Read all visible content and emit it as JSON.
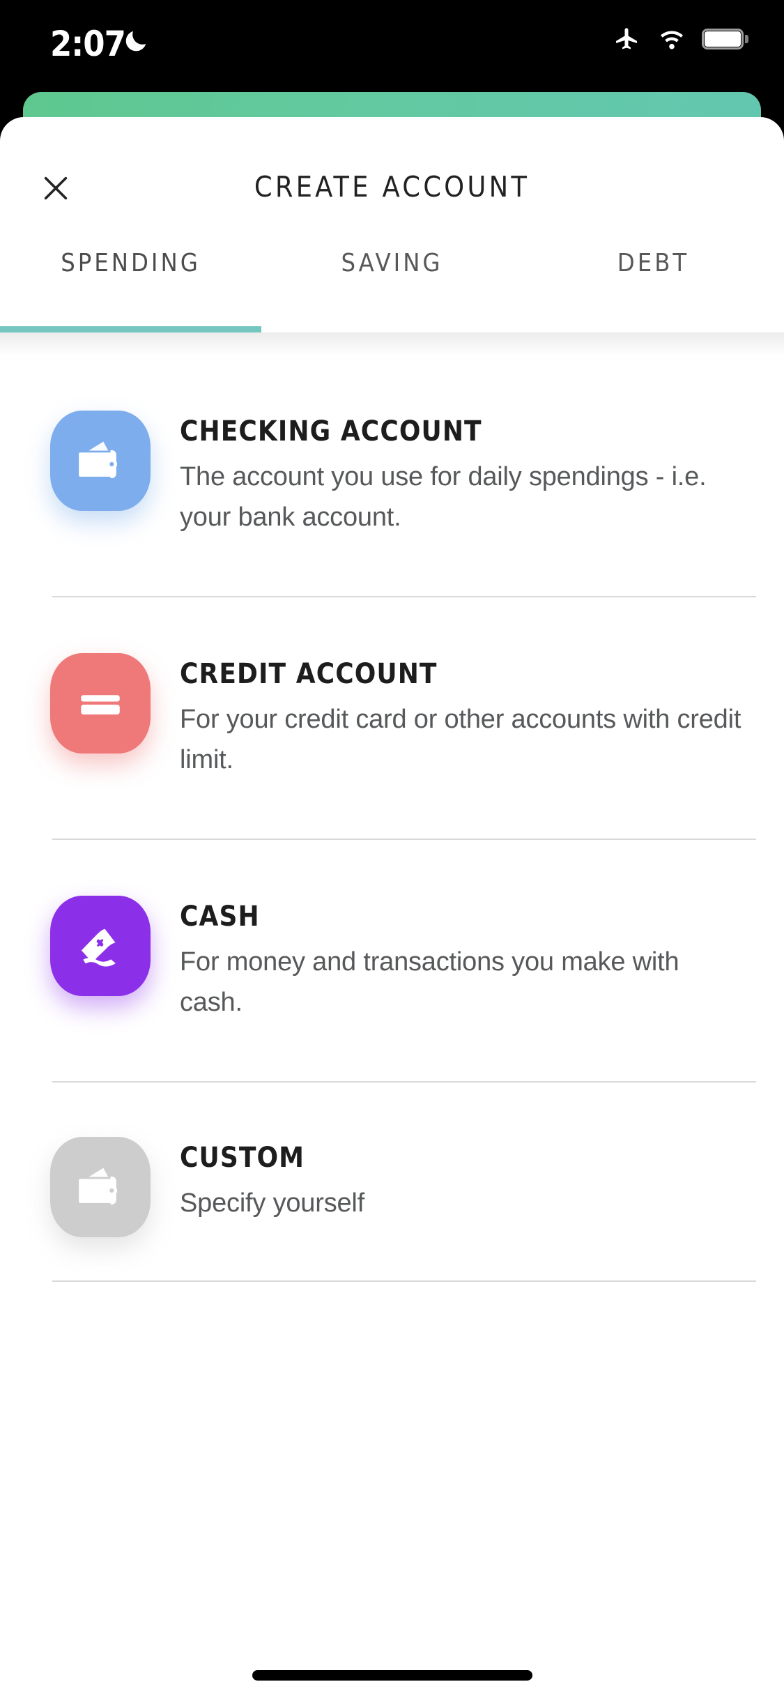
{
  "status_bar": {
    "time": "2:07",
    "icons": [
      "moon-icon",
      "airplane-mode-icon",
      "wifi-icon",
      "battery-icon"
    ]
  },
  "header": {
    "title": "CREATE ACCOUNT",
    "close_label": "close-icon"
  },
  "tabs": {
    "active_index": 0,
    "items": [
      {
        "label": "SPENDING"
      },
      {
        "label": "SAVING"
      },
      {
        "label": "DEBT"
      }
    ]
  },
  "accounts": [
    {
      "title": "CHECKING ACCOUNT",
      "description": "The account you use for daily spendings - i.e. your bank account.",
      "icon": "wallet-icon",
      "color": "#7dadec"
    },
    {
      "title": "CREDIT ACCOUNT",
      "description": "For your credit card or other accounts with credit limit.",
      "icon": "credit-card-icon",
      "color": "#ef7878"
    },
    {
      "title": "CASH",
      "description": "For money and transactions you make with cash.",
      "icon": "banknote-icon",
      "color": "#8c2fe8"
    },
    {
      "title": "CUSTOM",
      "description": "Specify yourself",
      "icon": "wallet-icon",
      "color": "#cdcdcd"
    }
  ],
  "colors": {
    "accent_teal": "#76c6c0",
    "sheet_background": "#ffffff",
    "ghost_card_gradient_start": "#5ec88f",
    "ghost_card_gradient_end": "#63c7b0",
    "divider": "#d9d9d9",
    "title_text": "#1d1d1d",
    "body_text": "#56585a"
  }
}
